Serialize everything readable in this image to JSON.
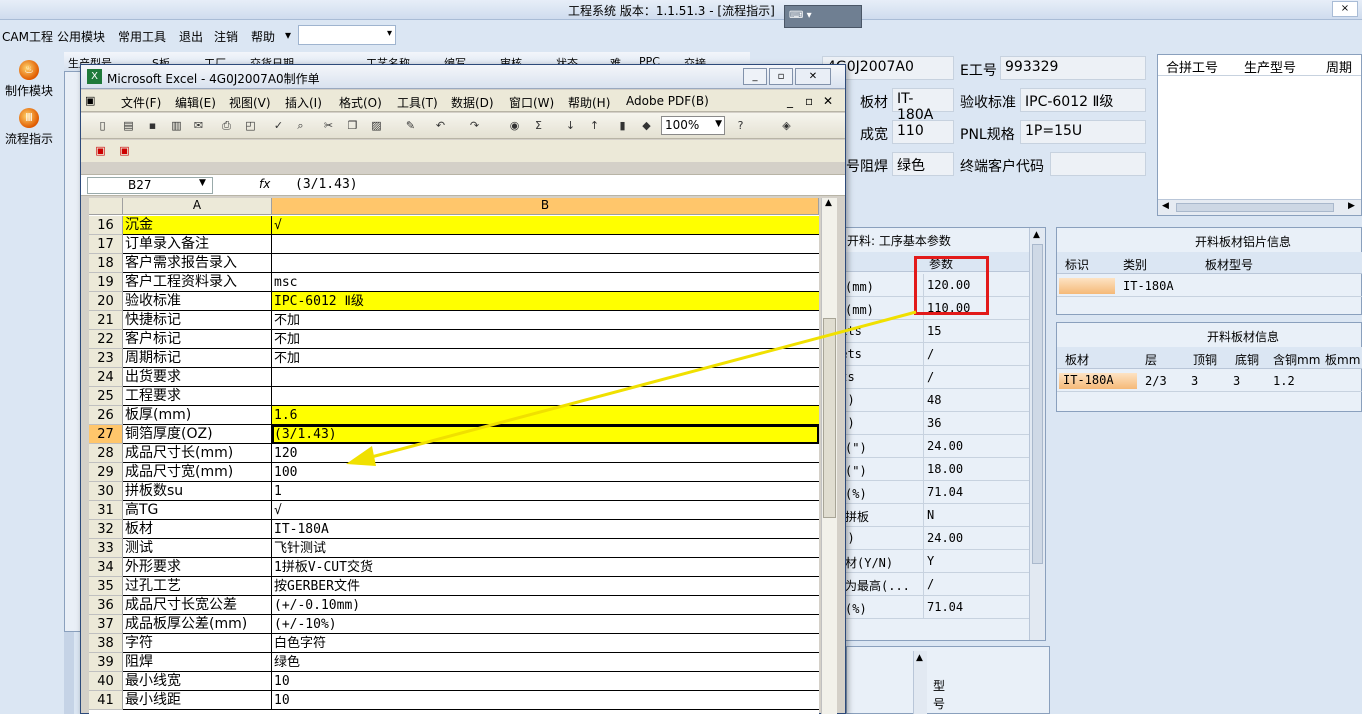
{
  "app": {
    "title": "工程系统  版本：1.1.51.3 - [流程指示]",
    "close_label": "×",
    "float_toolbar": "⌨ ▾"
  },
  "menu": {
    "items": [
      "CAM工程",
      "公用模块",
      "常用工具",
      "退出",
      "注销",
      "帮助"
    ]
  },
  "left_nav": {
    "items": [
      {
        "label": "制作模块",
        "icon": "flame-icon"
      },
      {
        "label": "流程指示",
        "icon": "flow-icon"
      }
    ]
  },
  "mid_header": {
    "cols": [
      "生产型号",
      "S板",
      "工厂",
      "交货日期"
    ],
    "tabs": [
      "工艺名称",
      "编写",
      "审核",
      "状态",
      "难",
      "PPC",
      "交接"
    ]
  },
  "top_form": {
    "code_value": "4G0J2007A0",
    "e_label": "E工号",
    "e_value": "993329",
    "board_label": "板材",
    "board_value": "IT-180A",
    "accept_label": "验收标准",
    "accept_value": "IPC-6012 Ⅱ级",
    "width_label": "成宽",
    "width_value": "110",
    "pnl_label": "PNL规格",
    "pnl_value": "1P=15U",
    "mask_prefix": "号",
    "mask_label": "阻焊",
    "mask_value": "绿色",
    "cust_label": "终端客户代码",
    "cust_value": ""
  },
  "merge_table": {
    "headers": [
      "合拼工号",
      "生产型号",
      "周期"
    ]
  },
  "params_panel": {
    "title": "开料: 工序基本参数",
    "col_header": "参数",
    "rows": [
      {
        "label": "长(mm)",
        "value": "120.00"
      },
      {
        "label": "宽(mm)",
        "value": "110.00"
      },
      {
        "label": "nits",
        "value": "15"
      },
      {
        "label": "Sets",
        "value": "/"
      },
      {
        "label": "its",
        "value": "/"
      },
      {
        "label": "(\")",
        "value": "48"
      },
      {
        "label": "(\")",
        "value": "36"
      },
      {
        "label": "长(\")",
        "value": "24.00"
      },
      {
        "label": "宽(\")",
        "value": "18.00"
      },
      {
        "label": "率(%)",
        "value": "71.04"
      },
      {
        "label": "只拼板",
        "value": "N"
      },
      {
        "label": "(\")",
        "value": "24.00"
      },
      {
        "label": "板材(Y/N)",
        "value": "Y"
      },
      {
        "label": "率为最高(...",
        "value": "/"
      },
      {
        "label": "率(%)",
        "value": "71.04"
      }
    ]
  },
  "foil_panel": {
    "title": "开料板材铝片信息",
    "headers": [
      "标识",
      "类别",
      "板材型号"
    ],
    "row": [
      "",
      "IT-180A",
      ""
    ]
  },
  "board_panel": {
    "title": "开料板材信息",
    "headers": [
      "板材",
      "层",
      "顶铜",
      "底铜",
      "含铜mm",
      "板mm"
    ],
    "row": [
      "IT-180A",
      "2/3",
      "3",
      "3",
      "1.2",
      ""
    ]
  },
  "bottom_panel": {
    "label": "型号"
  },
  "excel": {
    "title": "Microsoft Excel - 4G0J2007A0制作单",
    "menu": [
      "文件(F)",
      "编辑(E)",
      "视图(V)",
      "插入(I)",
      "格式(O)",
      "工具(T)",
      "数据(D)",
      "窗口(W)",
      "帮助(H)",
      "Adobe PDF(B)"
    ],
    "zoom": "100%",
    "cell_ref": "B27",
    "fx": "fx",
    "formula": "(3/1.43)",
    "col_a": "A",
    "col_b": "B",
    "rows": [
      {
        "n": "16",
        "a": "沉金",
        "b": "√",
        "hl": true
      },
      {
        "n": "17",
        "a": "订单录入备注",
        "b": ""
      },
      {
        "n": "18",
        "a": "客户需求报告录入",
        "b": ""
      },
      {
        "n": "19",
        "a": "客户工程资料录入",
        "b": "msc"
      },
      {
        "n": "20",
        "a": "验收标准",
        "b": "IPC-6012 Ⅱ级",
        "hlb": true
      },
      {
        "n": "21",
        "a": "快捷标记",
        "b": "不加"
      },
      {
        "n": "22",
        "a": "客户标记",
        "b": "不加"
      },
      {
        "n": "23",
        "a": "周期标记",
        "b": "不加"
      },
      {
        "n": "24",
        "a": "出货要求",
        "b": ""
      },
      {
        "n": "25",
        "a": "工程要求",
        "b": ""
      },
      {
        "n": "26",
        "a": "板厚(mm)",
        "b": "1.6",
        "hlb": true
      },
      {
        "n": "27",
        "a": "铜箔厚度(OZ)",
        "b": " (3/1.43)",
        "hlb": true,
        "sel": true
      },
      {
        "n": "28",
        "a": "成品尺寸长(mm)",
        "b": "120"
      },
      {
        "n": "29",
        "a": "成品尺寸宽(mm)",
        "b": "100"
      },
      {
        "n": "30",
        "a": "拼板数su",
        "b": "1"
      },
      {
        "n": "31",
        "a": "高TG",
        "b": "√"
      },
      {
        "n": "32",
        "a": "板材",
        "b": "IT-180A"
      },
      {
        "n": "33",
        "a": "测试",
        "b": "飞针测试"
      },
      {
        "n": "34",
        "a": "外形要求",
        "b": "1拼板V-CUT交货"
      },
      {
        "n": "35",
        "a": "过孔工艺",
        "b": "按GERBER文件"
      },
      {
        "n": "36",
        "a": "成品尺寸长宽公差",
        "b": "(+/-0.10mm)"
      },
      {
        "n": "37",
        "a": "成品板厚公差(mm)",
        "b": "(+/-10%)"
      },
      {
        "n": "38",
        "a": "字符",
        "b": "白色字符"
      },
      {
        "n": "39",
        "a": "阻焊",
        "b": "绿色"
      },
      {
        "n": "40",
        "a": "最小线宽",
        "b": "10"
      },
      {
        "n": "41",
        "a": "最小线距",
        "b": "10"
      }
    ]
  }
}
